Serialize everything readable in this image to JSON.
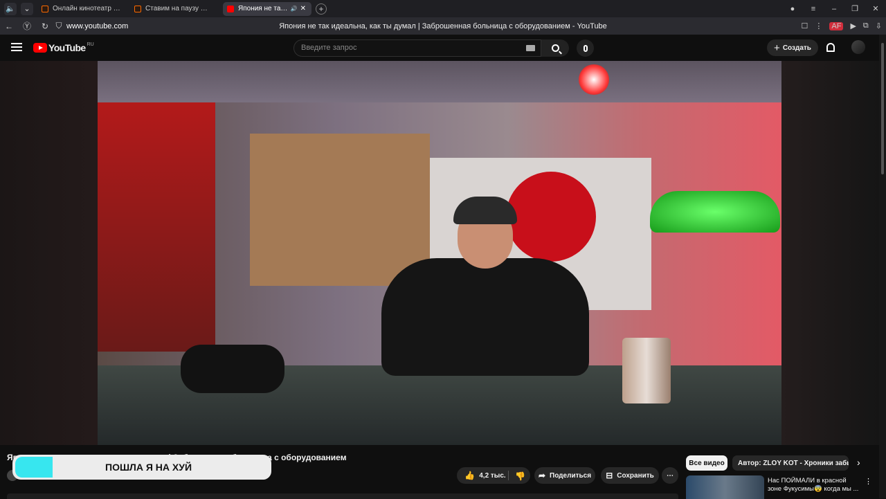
{
  "browser": {
    "tabs": [
      {
        "label": "Онлайн кинотеатр Кинопоиск",
        "active": false
      },
      {
        "label": "Ставим на паузу — узнай",
        "active": false
      },
      {
        "label": "Япония не так идеальна",
        "active": true
      }
    ],
    "url": "www.youtube.com",
    "page_title": "Япония не так идеальна, как ты думал | Заброшенная больница с оборудованием - YouTube",
    "extension_badge": "AF"
  },
  "youtube": {
    "logo_text": "YouTube",
    "logo_region": "RU",
    "search_placeholder": "Введите запрос",
    "create_label": "Создать",
    "create_plus": "+"
  },
  "video": {
    "title": "Япония не так идеальна, как ты думал | Заброшенная больница с оборудованием",
    "overlay_text": "ПОШЛА Я НА ХУЙ",
    "likes": "4,2 тыс.",
    "share_label": "Поделиться",
    "save_label": "Сохранить",
    "more_label": "⋯"
  },
  "sidebar": {
    "chips": [
      "Все видео",
      "Автор: ZLOY KOT - Хроники забытого"
    ],
    "recommendation": {
      "title": "Нас ПОЙМАЛИ в красной зоне Фукусимы😨 когда мы ..."
    }
  },
  "colors": {
    "accent_red": "#ff0000",
    "bg": "#0f0f0f",
    "overlay_cyan": "#37e6ef"
  },
  "icons": [
    "back-icon",
    "reload-icon",
    "lock-icon",
    "bookmark-icon",
    "menu-icon",
    "search-icon",
    "keyboard-icon",
    "mic-icon",
    "bell-icon",
    "like-icon",
    "dislike-icon",
    "share-icon",
    "save-icon"
  ]
}
